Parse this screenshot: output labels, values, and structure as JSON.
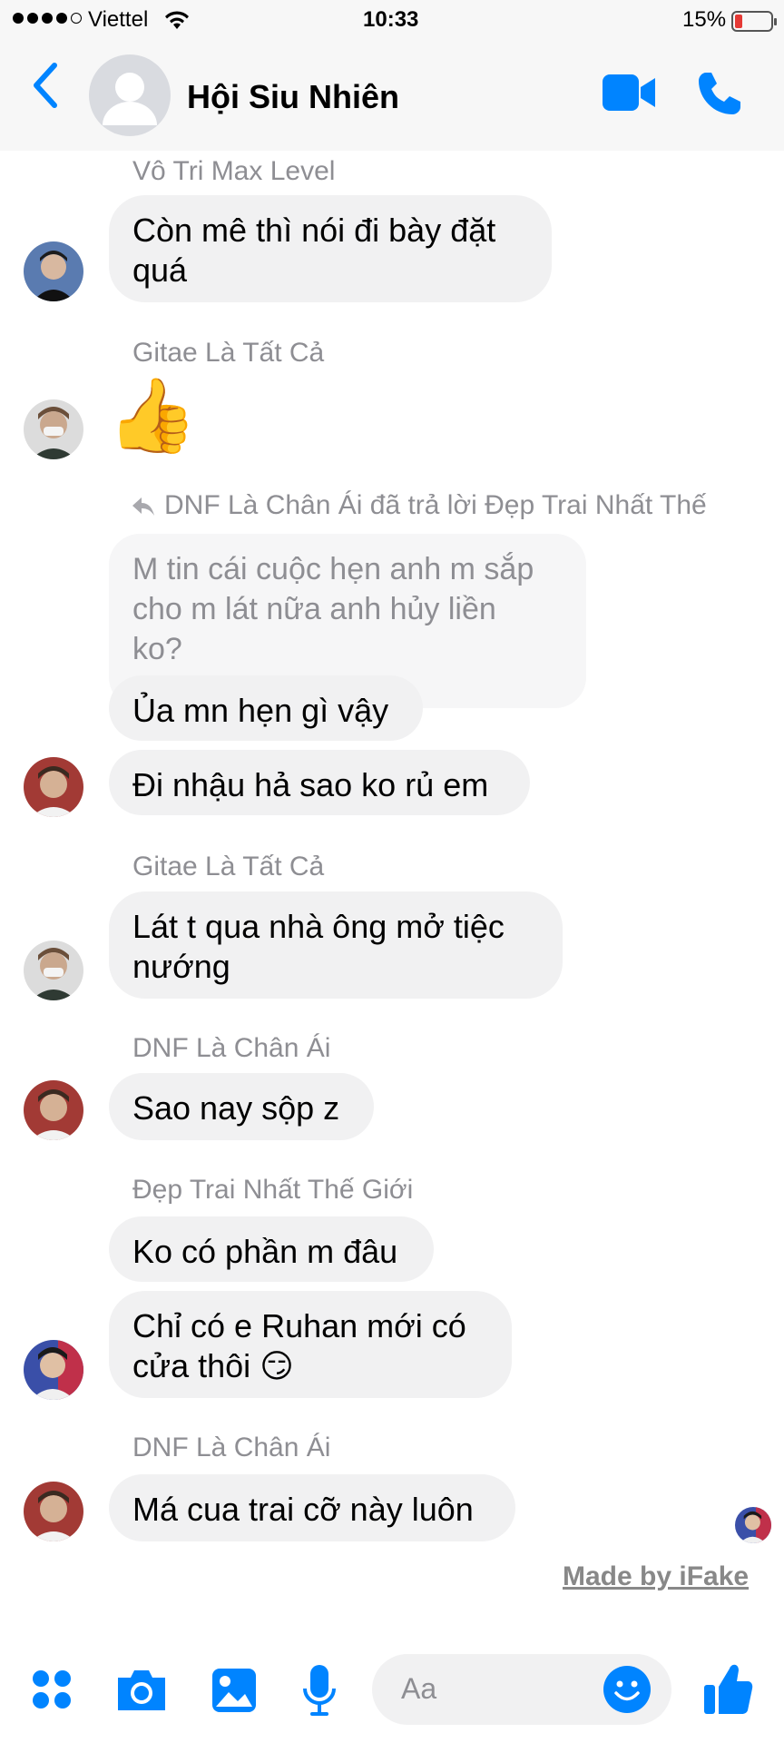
{
  "status_bar": {
    "carrier": "Viettel",
    "time": "10:33",
    "battery": "15%"
  },
  "header": {
    "title": "Hội Siu Nhiên",
    "back_icon": "chevron-left-icon",
    "video_icon": "video-camera-icon",
    "call_icon": "phone-icon"
  },
  "messages": [
    {
      "sender": "Vô Tri Max Level",
      "text": [
        "Còn mê thì nói đi bày đặt",
        "quá"
      ]
    },
    {
      "sender": "Gitae Là Tất Cả",
      "emoji": "👍"
    },
    {
      "reply_header": "DNF Là Chân Ái đã trả lời Đẹp Trai Nhất Thế",
      "quoted": [
        "M tin cái cuộc hẹn anh m sắp",
        "cho m lát nữa anh hủy liền",
        "ko?"
      ],
      "texts": [
        "Ủa mn hẹn gì vậy",
        "Đi nhậu hả sao ko rủ em"
      ]
    },
    {
      "sender": "Gitae Là Tất Cả",
      "text": [
        "Lát t qua nhà ông mở tiệc",
        "nướng"
      ]
    },
    {
      "sender": "DNF Là Chân Ái",
      "text": [
        "Sao nay sộp z"
      ]
    },
    {
      "sender": "Đẹp Trai Nhất Thế Giới",
      "text1": "Ko có phần m đâu",
      "text2": [
        "Chỉ có e Ruhan mới có",
        "cửa thôi"
      ],
      "emoji": "😏"
    },
    {
      "sender": "DNF Là Chân Ái",
      "text": [
        "Má cua trai cỡ này luôn"
      ]
    }
  ],
  "watermark": "Made by iFake",
  "composer": {
    "placeholder": "Aa"
  },
  "colors": {
    "accent": "#0084ff",
    "bubble": "#f1f1f2",
    "sender": "#8e8e93"
  }
}
